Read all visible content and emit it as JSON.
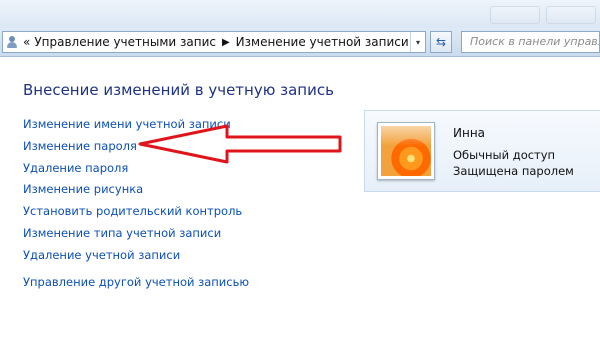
{
  "breadcrumb": {
    "overflow_glyph": "«",
    "item1": "Управление учетными запис",
    "separator": "▶",
    "item2": "Изменение учетной записи",
    "dropdown_glyph": "▾"
  },
  "refresh": {
    "glyph": "⇆"
  },
  "search": {
    "placeholder": "Поиск в панели управл"
  },
  "main": {
    "heading": "Внесение изменений в учетную запись",
    "links": [
      "Изменение имени учетной записи",
      "Изменение пароля",
      "Удаление пароля",
      "Изменение рисунка",
      "Установить родительский контроль",
      "Изменение типа учетной записи",
      "Удаление учетной записи",
      "Управление другой учетной записью"
    ]
  },
  "user": {
    "name": "Инна",
    "account_type": "Обычный доступ",
    "password_status": "Защищена паролем"
  },
  "colors": {
    "link": "#0b4fb4",
    "heading": "#1e3287",
    "annotation_arrow": "#e0141b"
  },
  "icons": [
    "user-accounts-icon",
    "chevron-right-icon",
    "dropdown-arrow-icon",
    "refresh-icon",
    "orange-flower-avatar"
  ]
}
